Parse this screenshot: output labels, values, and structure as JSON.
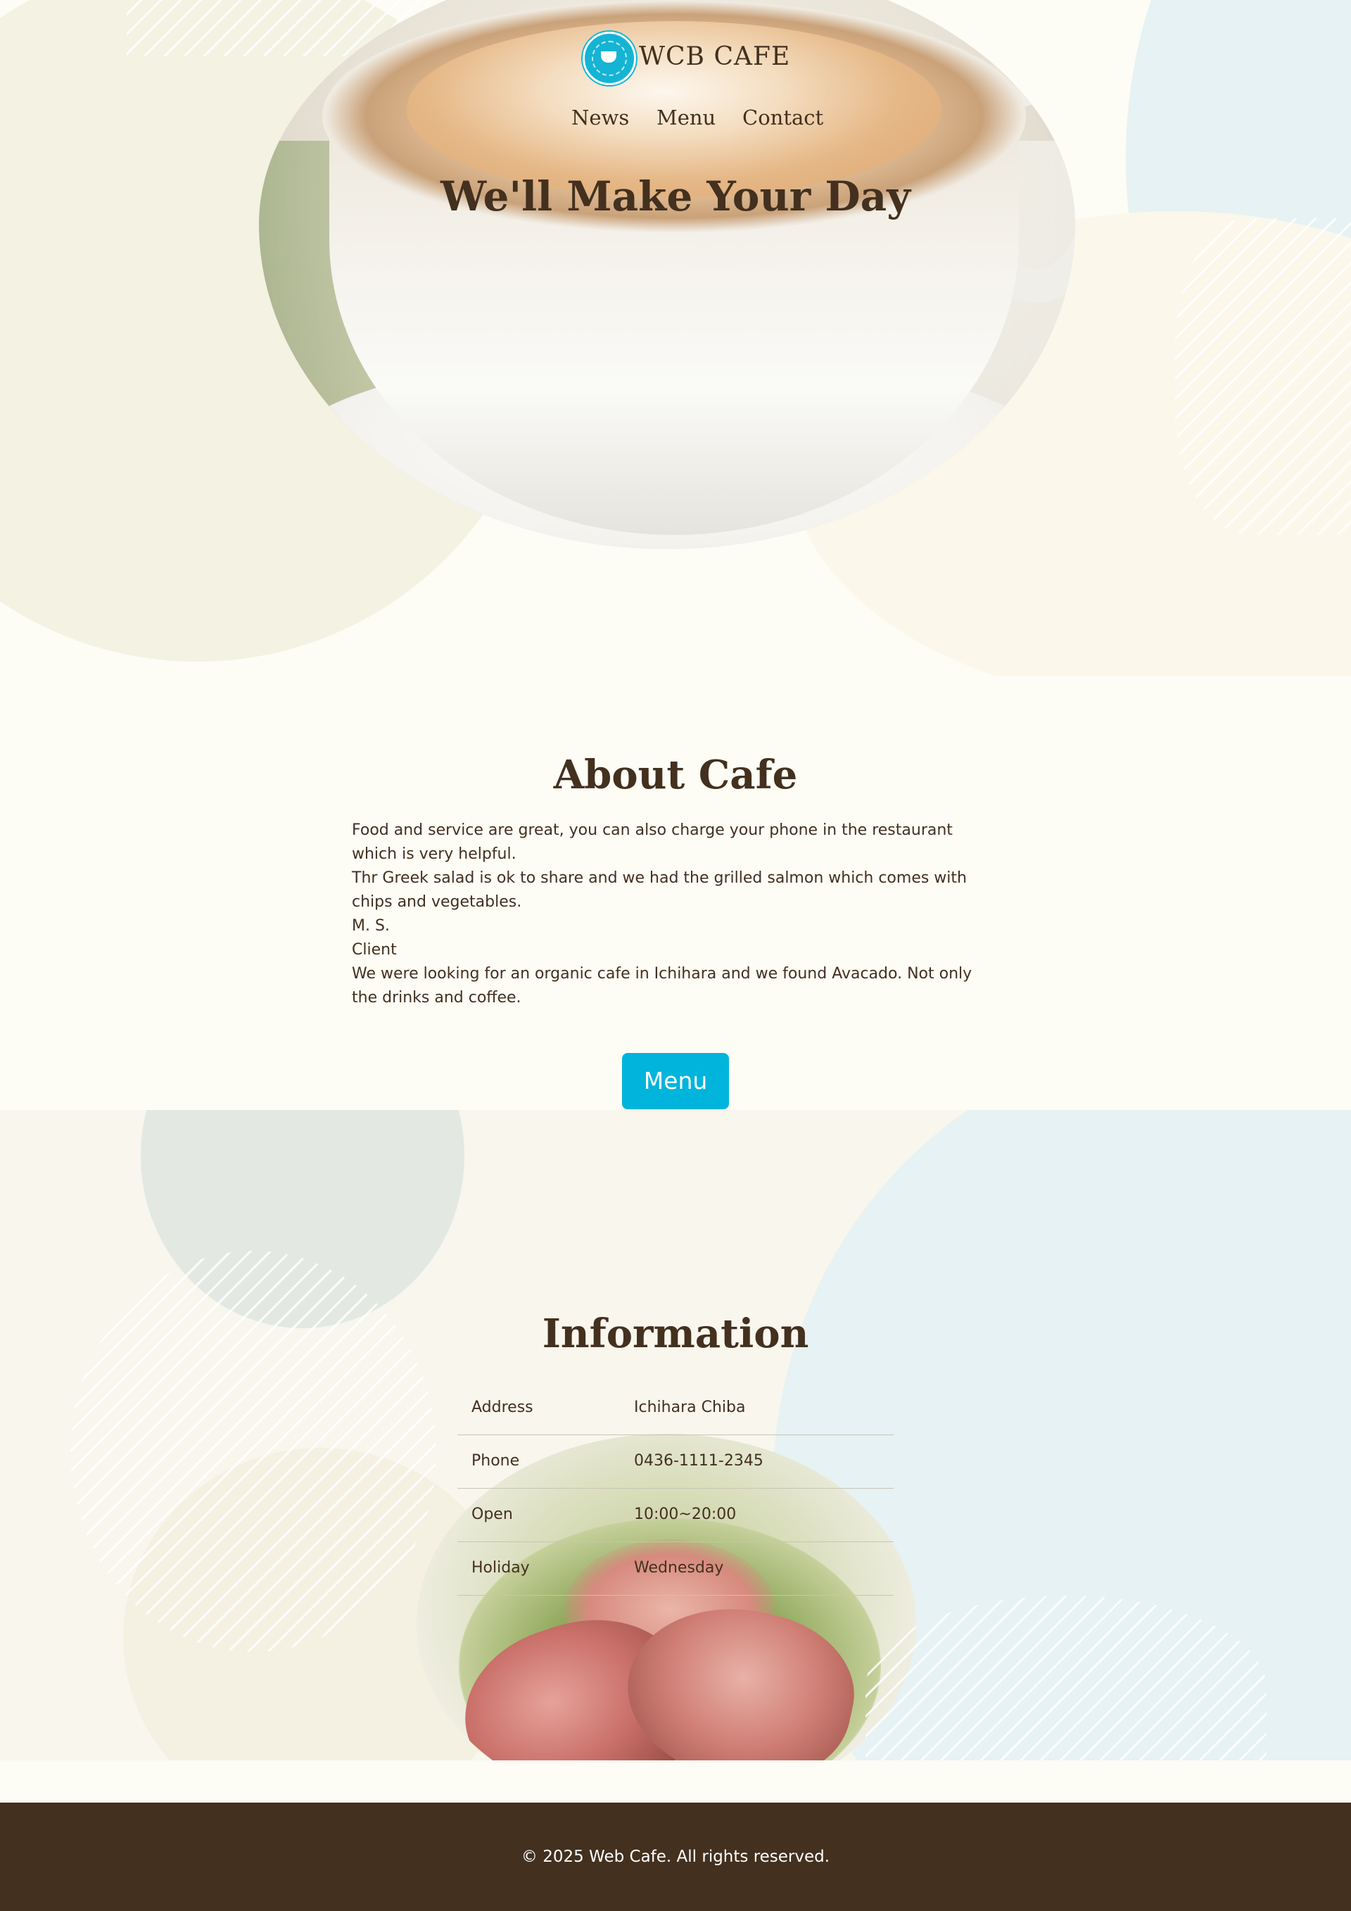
{
  "header": {
    "site_name": "WCB CAFE",
    "logo_icon": "cafe-logo-icon",
    "nav": [
      "News",
      "Menu",
      "Contact"
    ],
    "hero_title": "We'll Make Your Day"
  },
  "about": {
    "title": "About Cafe",
    "lines": [
      "Food and service are great, you can also charge your phone in the restaurant",
      "which is very helpful.",
      "Thr Greek salad is ok to share and we had the grilled salmon which comes with",
      "chips and vegetables.",
      "M. S.",
      "Client",
      "We were looking for an organic cafe in Ichihara and we found Avacado. Not only",
      "the drinks and coffee."
    ],
    "button_label": "Menu"
  },
  "information": {
    "title": "Information",
    "rows": [
      {
        "label": "Address",
        "value": "Ichihara Chiba"
      },
      {
        "label": "Phone",
        "value": "0436-1111-2345"
      },
      {
        "label": "Open",
        "value": "10:00~20:00"
      },
      {
        "label": "Holiday",
        "value": "Wednesday"
      }
    ]
  },
  "footer": {
    "copyright": "© 2025 Web Cafe. All rights reserved."
  },
  "colors": {
    "accent": "#00b4dc",
    "text": "#43301f",
    "background": "#fdfcf5",
    "footer": "#43301f"
  }
}
